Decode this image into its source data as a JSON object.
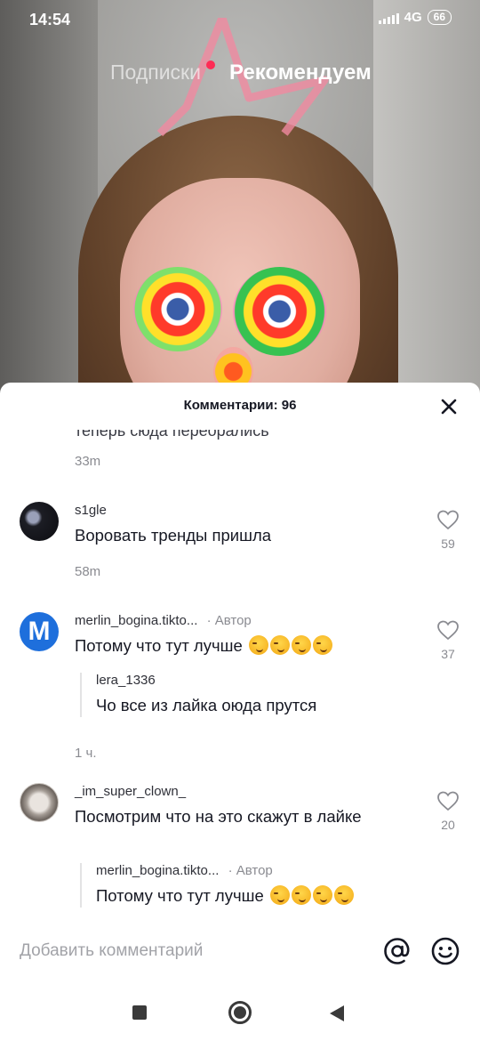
{
  "status_bar": {
    "time": "14:54",
    "network": "4G",
    "battery": "66"
  },
  "top_tabs": {
    "following": "Подписки",
    "for_you": "Рекомендуем"
  },
  "comments_sheet": {
    "title": "Комментарии: 96",
    "partial_comment": {
      "text": "теперь сюда переорались",
      "time": "33m"
    },
    "comments": [
      {
        "username": "s1gle",
        "text": "Воровать тренды пришла",
        "likes": "59",
        "time": "58m",
        "author": false
      },
      {
        "username": "merlin_bogina.tikto...",
        "author_label": "· Автор",
        "text": "Потому что тут лучше",
        "emoji": "smirking-face x4",
        "likes": "37",
        "reply": {
          "username": "lera_1336",
          "text": "Чо все из лайка оюда прутся"
        },
        "time": "1 ч."
      },
      {
        "username": "_im_super_clown_",
        "text": "Посмотрим что на это скажут в лайке",
        "likes": "20",
        "reply": {
          "username": "merlin_bogina.tikto...",
          "author_label": "· Автор",
          "text": "Потому что тут лучше",
          "emoji": "smirking-face x4"
        }
      }
    ],
    "input_placeholder": "Добавить комментарий",
    "icons": {
      "mention": "at-icon",
      "emoji": "emoji-icon",
      "close": "close-icon",
      "like": "heart-outline-icon"
    }
  },
  "colors": {
    "accent_red": "#fe2c55",
    "text_primary": "#161823",
    "text_secondary": "#8a8b91",
    "verified_blue": "#1e6fdc"
  }
}
